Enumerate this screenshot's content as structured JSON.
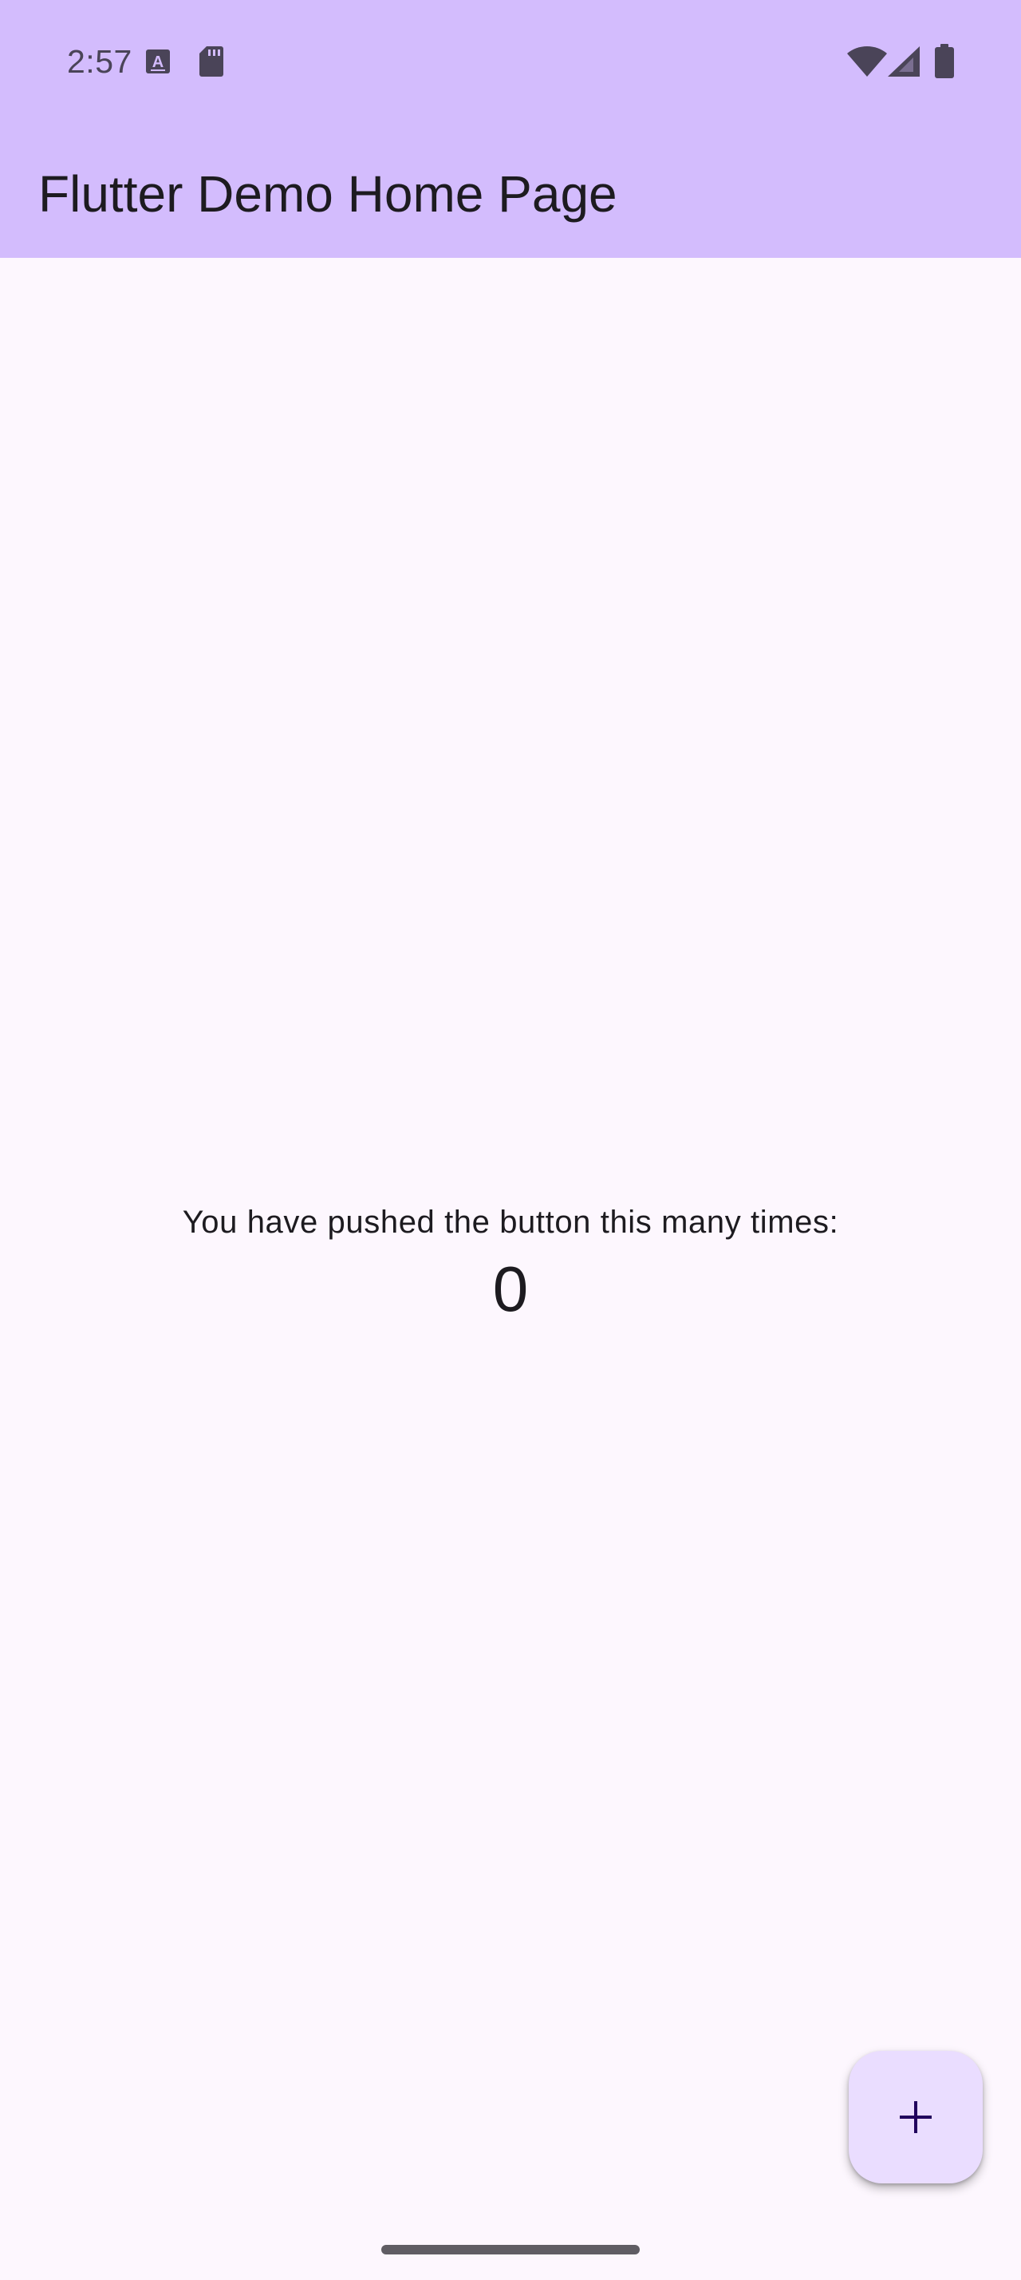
{
  "status_bar": {
    "time": "2:57",
    "left_icons": [
      "keyboard-a-icon",
      "sd-card-icon"
    ],
    "right_icons": [
      "wifi-icon",
      "cellular-signal-icon",
      "battery-icon"
    ]
  },
  "app_bar": {
    "title": "Flutter Demo Home Page"
  },
  "main": {
    "counter_label": "You have pushed the button this many times:",
    "counter_value": "0"
  },
  "fab": {
    "icon": "plus-icon",
    "action": "increment"
  },
  "colors": {
    "app_bar_background": "#d3bcfd",
    "page_background": "#fdf7fe",
    "fab_background": "#eaddff",
    "text_primary": "#1d1b20",
    "status_icons": "#4a4458"
  }
}
